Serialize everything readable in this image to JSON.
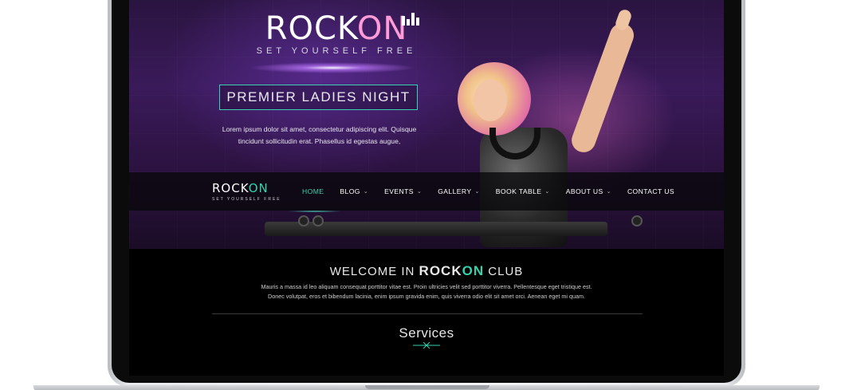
{
  "brand": {
    "name_part1": "ROCK",
    "name_part2": "ON",
    "tagline": "SET YOURSELF FREE"
  },
  "hero": {
    "ribbon_title": "PREMIER LADIES NIGHT",
    "text_line1": "Lorem ipsum dolor sit amet, consectetur adipiscing elit. Quisque",
    "text_line2": "tincidunt sollicitudin erat. Phasellus id egestas augue,"
  },
  "nav": {
    "items": [
      {
        "label": "HOME",
        "active": true,
        "has_dropdown": false
      },
      {
        "label": "BLOG",
        "active": false,
        "has_dropdown": true
      },
      {
        "label": "EVENTS",
        "active": false,
        "has_dropdown": true
      },
      {
        "label": "GALLERY",
        "active": false,
        "has_dropdown": true
      },
      {
        "label": "BOOK TABLE",
        "active": false,
        "has_dropdown": true
      },
      {
        "label": "ABOUT US",
        "active": false,
        "has_dropdown": true
      },
      {
        "label": "CONTACT US",
        "active": false,
        "has_dropdown": false
      }
    ],
    "dropdown_glyph": "⌄"
  },
  "welcome": {
    "prefix": "WELCOME IN",
    "bold_part1": "ROCK",
    "bold_part2": "ON",
    "suffix": "CLUB",
    "line1": "Mauris a massa id leo aliquam consequat porttitor vitae est. Proin ultricies velit sed porttitor viverra. Pellentesque eget tristique est.",
    "line2": "Donec volutpat, eros et bibendum lacinia, enim ipsum gravida enim, quis viverra odio elit sit amet orci. Aenean eget mi quam."
  },
  "services": {
    "title": "Services"
  },
  "colors": {
    "accent": "#35d1ad",
    "hero_purple": "#3a1a5a",
    "hero_pink": "#ff9cd8",
    "text_light": "#e8e8e8",
    "screen_bg": "#000000"
  },
  "icons": {
    "eq_icon": "equalizer-icon",
    "chevron": "chevron-down-icon",
    "services_mark": "crossed-lines-icon"
  }
}
